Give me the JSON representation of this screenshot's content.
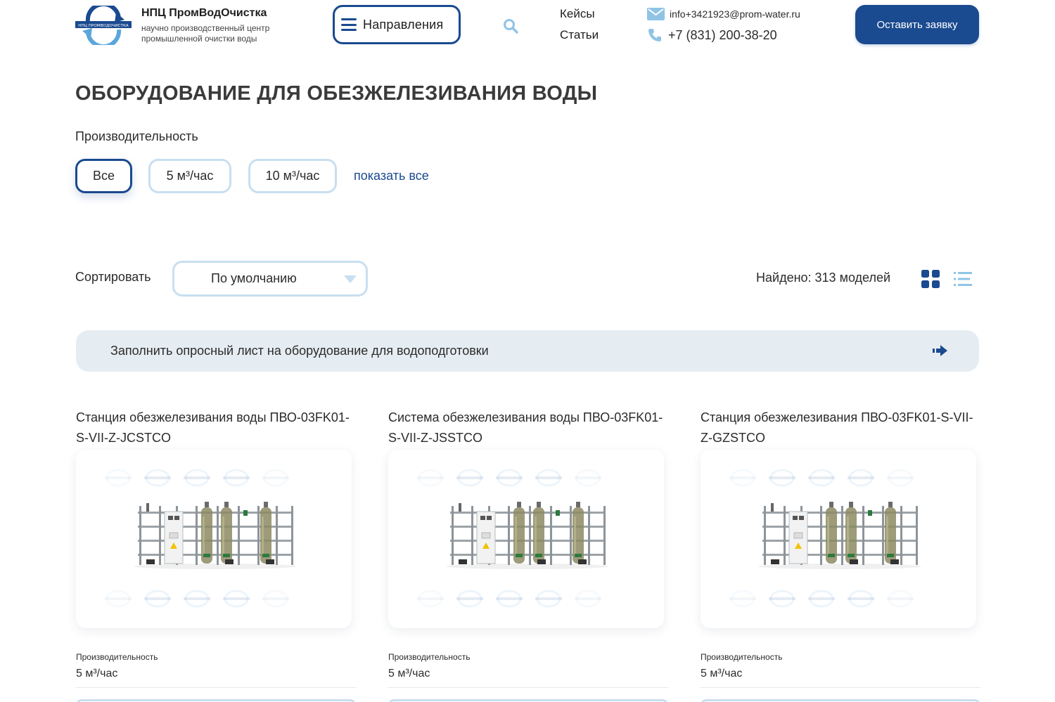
{
  "header": {
    "logo_text": "НПЦ ПРОМВОДОЧИСТКА",
    "brand_name": "НПЦ ПромВодОчистка",
    "brand_sub": "научно производственный центр промышленной очистки воды",
    "nav_button": "Направления",
    "links": [
      "Кейсы",
      "Статьи"
    ],
    "email": "info+3421923@prom-water.ru",
    "phone": "+7 (831) 200-38-20",
    "cta": "Оставить заявку"
  },
  "page_title": "ОБОРУДОВАНИЕ ДЛЯ ОБЕЗЖЕЛЕЗИВАНИЯ ВОДЫ",
  "filters": {
    "label": "Производительность",
    "chips": [
      {
        "label": "Все",
        "active": true
      },
      {
        "label": "5 м³/час",
        "active": false
      },
      {
        "label": "10 м³/час",
        "active": false
      }
    ],
    "show_all": "показать все"
  },
  "sort": {
    "label": "Сортировать",
    "selected": "По умолчанию",
    "found": "Найдено: 313 моделей"
  },
  "banner": "Заполнить опросный лист на оборудование для водоподготовки",
  "products": [
    {
      "title": "Станция обезжелезивания воды ПВО-03FK01-S-VII-Z-JCSTCO",
      "spec_label": "Производительность",
      "spec_value": "5 м³/час"
    },
    {
      "title": "Система обезжелезивания воды ПВО-03FK01-S-VII-Z-JSSTCO",
      "spec_label": "Производительность",
      "spec_value": "5 м³/час"
    },
    {
      "title": "Станция обезжелезивания ПВО-03FK01-S-VII-Z-GZSTCO",
      "spec_label": "Производительность",
      "spec_value": "5 м³/час"
    }
  ],
  "colors": {
    "brand": "#1a4a8f",
    "chip_border": "#c8dff0",
    "banner_bg": "#e6edf2",
    "icon_light": "#8fc4e6"
  },
  "icons": {
    "nav": "menu-icon",
    "search": "search-icon",
    "mail": "mail-icon",
    "phone": "phone-icon",
    "sort": "chevron-down-icon",
    "view_grid": "grid-view-icon",
    "view_list": "list-view-icon",
    "banner": "arrow-right-icon"
  }
}
